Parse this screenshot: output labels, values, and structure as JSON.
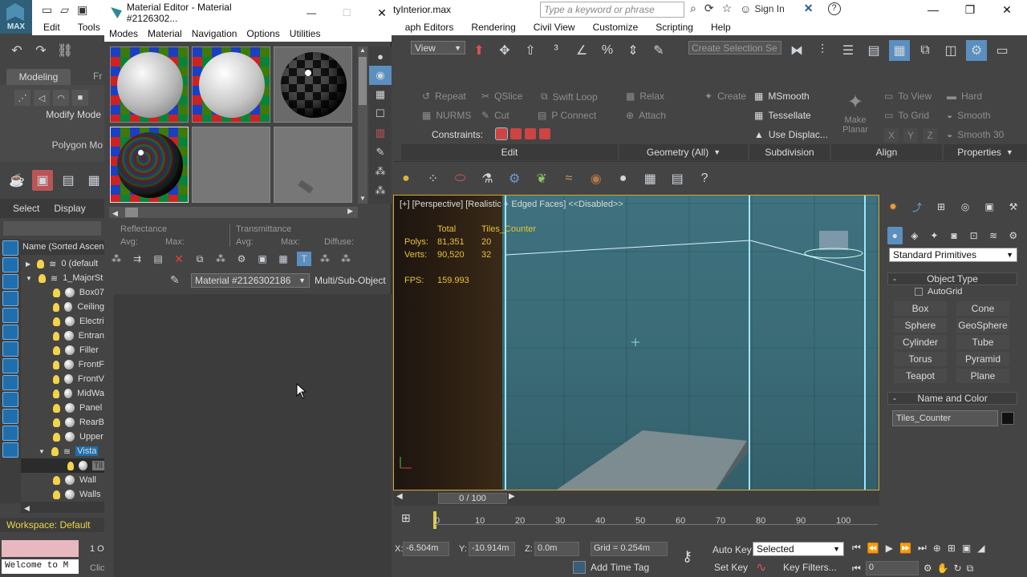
{
  "app": {
    "logo_label": "MAX",
    "title_fragment": "tyInterior.max",
    "search_placeholder": "Type a keyword or phrase",
    "sign_in": "Sign In",
    "help_glyph": "?"
  },
  "main_menu": [
    "Edit",
    "Tools",
    "aph Editors",
    "Rendering",
    "Civil View",
    "Customize",
    "Scripting",
    "Help"
  ],
  "toolbar": {
    "view_select": "View",
    "selection_set_placeholder": "Create Selection Se"
  },
  "ribbon": {
    "tabs": [
      "Modeling",
      "Fr"
    ],
    "left_labels": {
      "modify_mode": "Modify Mode",
      "polygon_mode": "Polygon Mo"
    },
    "items": {
      "repeat": "Repeat",
      "qslice": "QSlice",
      "swift_loop": "Swift Loop",
      "relax": "Relax",
      "create": "Create",
      "msmooth": "MSmooth",
      "to_view": "To View",
      "hard": "Hard",
      "nurms": "NURMS",
      "cut": "Cut",
      "p_connect": "P Connect",
      "attach": "Attach",
      "tessellate": "Tessellate",
      "to_grid": "To Grid",
      "smooth": "Smooth",
      "constraints": "Constraints:",
      "use_displace": "Use Displac...",
      "make_planar": "Make Planar",
      "x": "X",
      "y": "Y",
      "z": "Z",
      "smooth30": "Smooth 30"
    },
    "groups": {
      "edit": "Edit",
      "geometry": "Geometry (All)",
      "subdivision": "Subdivision",
      "align": "Align",
      "properties": "Properties"
    }
  },
  "scene_explorer": {
    "tabs": [
      "Select",
      "Display"
    ],
    "column_header": "Name (Sorted Ascen",
    "items": [
      {
        "label": "0 (default",
        "depth": 0,
        "type": "layer"
      },
      {
        "label": "1_MajorSt",
        "depth": 0,
        "type": "layer"
      },
      {
        "label": "Box07",
        "depth": 1,
        "type": "obj"
      },
      {
        "label": "Ceiling",
        "depth": 1,
        "type": "obj"
      },
      {
        "label": "Electri",
        "depth": 1,
        "type": "obj"
      },
      {
        "label": "Entran",
        "depth": 1,
        "type": "obj"
      },
      {
        "label": "Filler",
        "depth": 1,
        "type": "obj"
      },
      {
        "label": "FrontF",
        "depth": 1,
        "type": "obj"
      },
      {
        "label": "FrontV",
        "depth": 1,
        "type": "obj"
      },
      {
        "label": "MidWa",
        "depth": 1,
        "type": "obj"
      },
      {
        "label": "Panel",
        "depth": 1,
        "type": "obj"
      },
      {
        "label": "RearB",
        "depth": 1,
        "type": "obj"
      },
      {
        "label": "Upper",
        "depth": 1,
        "type": "obj"
      },
      {
        "label": "Vista",
        "depth": 1,
        "type": "layer-sel"
      },
      {
        "label": "Til",
        "depth": 2,
        "type": "obj-sel"
      },
      {
        "label": "Wall",
        "depth": 1,
        "type": "obj"
      },
      {
        "label": "Walls",
        "depth": 1,
        "type": "obj"
      }
    ],
    "workspace": "Workspace: Default",
    "welcome": "Welcome to M",
    "status_fragment": "1 O",
    "click_fragment": "Clic"
  },
  "material_editor": {
    "title": "Material Editor - Material #2126302...",
    "menu": [
      "Modes",
      "Material",
      "Navigation",
      "Options",
      "Utilities"
    ],
    "reflectance": "Reflectance",
    "transmittance": "Transmittance",
    "avg": "Avg:",
    "max": "Max:",
    "diffuse": "Diffuse:",
    "material_name": "Material #2126302186",
    "material_type": "Multi/Sub-Object"
  },
  "viewport": {
    "label": "[+] [Perspective] [Realistic + Edged Faces]  <<Disabled>>",
    "stats": {
      "total": "Total",
      "object": "Tiles_Counter",
      "polys_label": "Polys:",
      "polys_total": "81,351",
      "polys_obj": "20",
      "verts_label": "Verts:",
      "verts_total": "90,520",
      "verts_obj": "32",
      "fps_label": "FPS:",
      "fps_value": "159.993"
    }
  },
  "command_panel": {
    "category": "Standard Primitives",
    "object_type": "Object Type",
    "autogrid": "AutoGrid",
    "primitives": [
      "Box",
      "Cone",
      "Sphere",
      "GeoSphere",
      "Cylinder",
      "Tube",
      "Torus",
      "Pyramid",
      "Teapot",
      "Plane"
    ],
    "name_and_color": "Name and Color",
    "object_name": "Tiles_Counter",
    "object_color": "#111111"
  },
  "timeline": {
    "frame": "0 / 100",
    "ticks": [
      "0",
      "10",
      "20",
      "30",
      "40",
      "50",
      "60",
      "70",
      "80",
      "90",
      "100"
    ]
  },
  "status": {
    "x_label": "X:",
    "x_value": "-6.504m",
    "y_label": "Y:",
    "y_value": "-10.914m",
    "z_label": "Z:",
    "z_value": "0.0m",
    "grid": "Grid = 0.254m",
    "add_time_tag": "Add Time Tag",
    "auto_key": "Auto Key",
    "selected": "Selected",
    "set_key": "Set Key",
    "key_filters": "Key Filters...",
    "frame_value": "0"
  },
  "colors": {
    "accent_blue": "#1f6fae",
    "viewport_border": "#d6a634",
    "stat_yellow": "#e6c23a",
    "workspace_yellow": "#e8d84a"
  }
}
